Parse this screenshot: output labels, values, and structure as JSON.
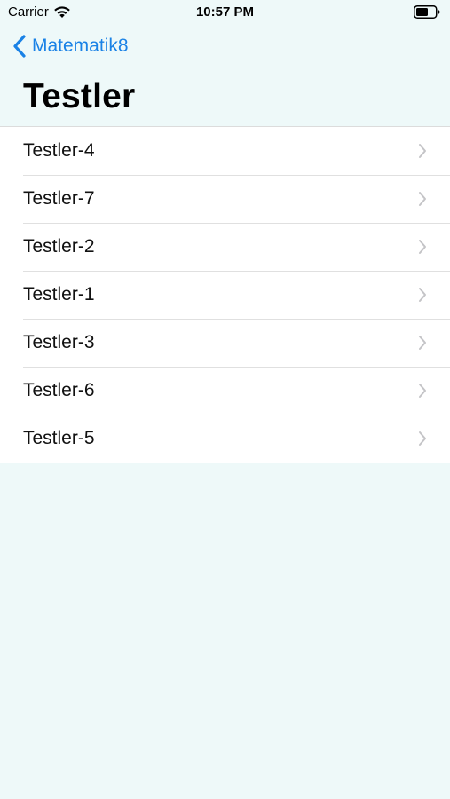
{
  "status_bar": {
    "carrier": "Carrier",
    "time": "10:57 PM",
    "icons": [
      "wifi-icon",
      "battery-icon"
    ]
  },
  "nav": {
    "back_label": "Matematik8",
    "title": "Testler"
  },
  "list": {
    "items": [
      {
        "label": "Testler-4"
      },
      {
        "label": "Testler-7"
      },
      {
        "label": "Testler-2"
      },
      {
        "label": "Testler-1"
      },
      {
        "label": "Testler-3"
      },
      {
        "label": "Testler-6"
      },
      {
        "label": "Testler-5"
      }
    ]
  },
  "colors": {
    "background": "#eef9f9",
    "accent": "#1a82e6",
    "chevron": "#c4c4c7",
    "separator": "#e0e0e0"
  }
}
